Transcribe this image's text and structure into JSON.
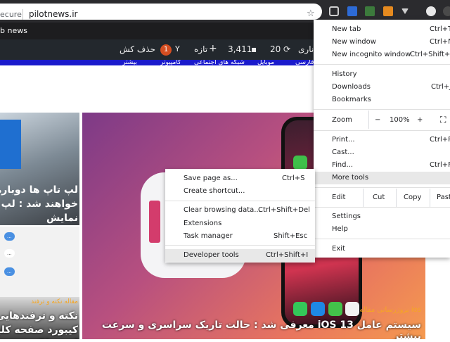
{
  "browser": {
    "security_label": "ecure",
    "url": "pilotnews.ir",
    "bookmark": "b news"
  },
  "admin_bar": {
    "delete_label": "حذف کش",
    "badge_count": "1",
    "new_label": "تازه",
    "comments_count": "3,411",
    "updates_count": "20",
    "partial_label": "ناری"
  },
  "site_nav": {
    "items": [
      "بیشتر",
      "کامپیوتر",
      "شبکه های اجتماعی",
      "موبایل",
      "فارسی"
    ]
  },
  "cards": {
    "left_top": {
      "title": "لپ تاپ ها دوباره عر خواهند شد : لپ تاپ نمایش"
    },
    "left_bottom": {
      "category": "مقاله نکته و ترفند",
      "title": "نکته و ترفندهایی کیبورد صفحه کلید Gboard"
    },
    "main": {
      "category": "ios بروزرسانی مقاله",
      "title": "سیستم عامل iOS 13 معرفی شد : حالت تاریک سراسری و سرعت بیشتر"
    }
  },
  "chrome_menu": {
    "new_tab": "New tab",
    "new_tab_sc": "Ctrl+T",
    "new_window": "New window",
    "new_window_sc": "Ctrl+N",
    "incognito": "New incognito window",
    "incognito_sc": "Ctrl+Shift+N",
    "history": "History",
    "downloads": "Downloads",
    "downloads_sc": "Ctrl+J",
    "bookmarks": "Bookmarks",
    "zoom": "Zoom",
    "zoom_minus": "−",
    "zoom_value": "100%",
    "zoom_plus": "+",
    "print": "Print...",
    "print_sc": "Ctrl+P",
    "cast": "Cast...",
    "find": "Find...",
    "find_sc": "Ctrl+F",
    "more_tools": "More tools",
    "edit": "Edit",
    "cut": "Cut",
    "copy": "Copy",
    "paste": "Past",
    "settings": "Settings",
    "help": "Help",
    "exit": "Exit"
  },
  "more_tools_menu": {
    "save_page": "Save page as...",
    "save_page_sc": "Ctrl+S",
    "create_shortcut": "Create shortcut...",
    "clear_data": "Clear browsing data...",
    "clear_data_sc": "Ctrl+Shift+Del",
    "extensions": "Extensions",
    "task_manager": "Task manager",
    "task_manager_sc": "Shift+Esc",
    "dev_tools": "Developer tools",
    "dev_tools_sc": "Ctrl+Shift+I"
  },
  "colors": {
    "toolbar": "#2b2b2e",
    "admin_bar": "#23282d",
    "site_nav": "#1a1acc",
    "badge": "#d54e21",
    "category": "#f5a623"
  }
}
